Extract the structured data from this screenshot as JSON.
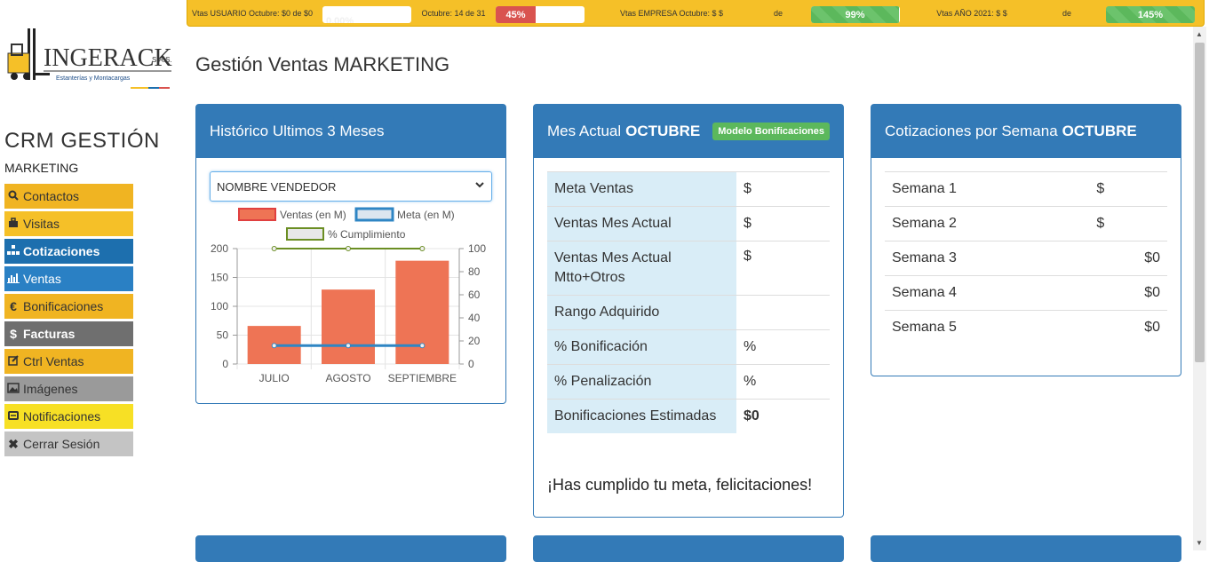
{
  "topbar": {
    "user_label": "Vtas USUARIO Octubre: $0 de $0",
    "user_pct": "0.00%",
    "day_label": "Octubre: 14 de 31",
    "day_pct": "45%",
    "day_fill": 0.45,
    "company_label": "Vtas EMPRESA Octubre: $ $",
    "company_de": "de",
    "company_pct": "99%",
    "company_fill": 0.99,
    "year_label": "Vtas AÑO 2021: $ $",
    "year_de": "de",
    "year_pct": "145%",
    "year_fill": 1.0
  },
  "logo": {
    "name": "INGERACK",
    "suffix": "S.A.S.",
    "tagline": "Estanterías y Montacargas"
  },
  "sidebar": {
    "title": "CRM GESTIÓN",
    "subtitle": "MARKETING",
    "items": [
      {
        "label": "Contactos",
        "icon": "search-icon"
      },
      {
        "label": "Visitas",
        "icon": "briefcase-icon"
      },
      {
        "label": "Cotizaciones",
        "icon": "sitemap-icon"
      },
      {
        "label": "Ventas",
        "icon": "bar-chart-icon"
      },
      {
        "label": "Bonificaciones",
        "icon": "euro-icon"
      },
      {
        "label": "Facturas",
        "icon": "dollar-icon"
      },
      {
        "label": "Ctrl Ventas",
        "icon": "edit-icon"
      },
      {
        "label": "Imágenes",
        "icon": "image-icon"
      },
      {
        "label": "Notificaciones",
        "icon": "message-icon"
      },
      {
        "label": "Cerrar Sesión",
        "icon": "close-icon"
      }
    ]
  },
  "main": {
    "title": "Gestión Ventas MARKETING"
  },
  "historico": {
    "title": "Histórico Ultimos 3 Meses",
    "select_value": "NOMBRE VENDEDOR",
    "legend": [
      "Ventas (en M)",
      "Meta (en M)",
      "% Cumplimiento"
    ]
  },
  "chart_data": {
    "type": "bar",
    "categories": [
      "JULIO",
      "AGOSTO",
      "SEPTIEMBRE"
    ],
    "series": [
      {
        "name": "Ventas (en M)",
        "type": "bar",
        "axis": "left",
        "values": [
          66,
          129,
          179
        ],
        "color": "#ee7455"
      },
      {
        "name": "Meta (en M)",
        "type": "line",
        "axis": "left",
        "values": [
          32,
          32,
          32
        ],
        "color": "#2f86c4"
      },
      {
        "name": "% Cumplimiento",
        "type": "line",
        "axis": "right",
        "values": [
          100,
          100,
          100
        ],
        "color": "#6b8e23"
      }
    ],
    "y_left": {
      "ticks": [
        "0",
        "50",
        "100",
        "150",
        "200"
      ],
      "range": [
        0,
        200
      ]
    },
    "y_right": {
      "ticks": [
        "0",
        "20",
        "40",
        "60",
        "80",
        "100"
      ],
      "range": [
        0,
        100
      ]
    },
    "grid": true,
    "legend_position": "top"
  },
  "mes": {
    "title_prefix": "Mes Actual",
    "title_bold": "OCTUBRE",
    "badge": "Modelo Bonificaciones",
    "rows": [
      {
        "k": "Meta Ventas",
        "v": "$"
      },
      {
        "k": "Ventas Mes Actual",
        "v": "$"
      },
      {
        "k": "Ventas Mes Actual Mtto+Otros",
        "v": "$"
      },
      {
        "k": "Rango Adquirido",
        "v": ""
      },
      {
        "k": "% Bonificación",
        "v": "%"
      },
      {
        "k": "% Penalización",
        "v": "%"
      },
      {
        "k": "Bonificaciones Estimadas",
        "v": "$0"
      }
    ],
    "message": "¡Has cumplido tu meta, felicitaciones!"
  },
  "semanas": {
    "title_prefix": "Cotizaciones por Semana",
    "title_bold": "OCTUBRE",
    "rows": [
      {
        "k": "Semana 1",
        "v": "$",
        "cur": true
      },
      {
        "k": "Semana 2",
        "v": "$",
        "cur": true
      },
      {
        "k": "Semana 3",
        "v": "$0",
        "cur": false
      },
      {
        "k": "Semana 4",
        "v": "$0",
        "cur": false
      },
      {
        "k": "Semana 5",
        "v": "$0",
        "cur": false
      }
    ]
  },
  "colors": {
    "primary": "#337ab7",
    "warning": "#f5c028",
    "success": "#5cb85c",
    "danger": "#d9534f"
  }
}
